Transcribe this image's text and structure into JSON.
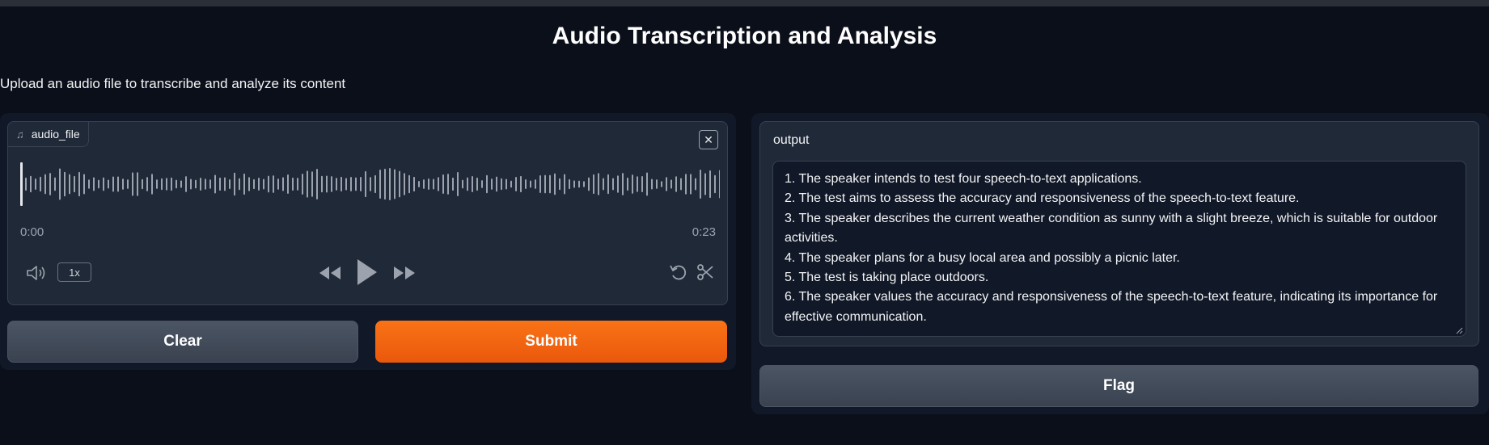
{
  "header": {
    "title": "Audio Transcription and Analysis",
    "description": "Upload an audio file to transcribe and analyze its content"
  },
  "audio": {
    "label": "audio_file",
    "icon": "music-note-icon",
    "time_start": "0:00",
    "time_end": "0:23",
    "speed": "1x",
    "controls": [
      "volume-icon",
      "rewind-icon",
      "play-icon",
      "fast-forward-icon",
      "undo-icon",
      "scissors-icon"
    ]
  },
  "buttons": {
    "clear": "Clear",
    "submit": "Submit",
    "flag": "Flag"
  },
  "output": {
    "label": "output",
    "lines": [
      " 1. The speaker intends to test four speech-to-text applications.",
      "2. The test aims to assess the accuracy and responsiveness of the speech-to-text feature.",
      "3. The speaker describes the current weather condition as sunny with a slight breeze, which is suitable for outdoor activities.",
      "4. The speaker plans for a busy local area and possibly a picnic later.",
      "5. The test is taking place outdoors.",
      "6. The speaker values the accuracy and responsiveness of the speech-to-text feature, indicating its importance for effective communication."
    ]
  },
  "colors": {
    "background": "#0b0f19",
    "panel": "#111827",
    "block": "#1f2937",
    "accent": "#f97316",
    "waveform": "#9ca3af"
  }
}
